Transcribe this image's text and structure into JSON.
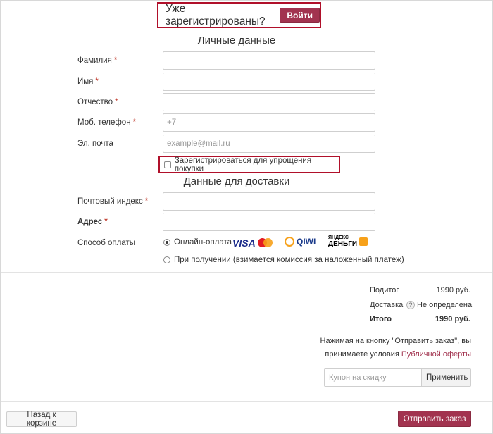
{
  "header": {
    "registered_question": "Уже зарегистрированы?",
    "login_button": "Войти"
  },
  "personal": {
    "title": "Личные данные",
    "fields": [
      {
        "label": "Фамилия",
        "required": "*",
        "value": "",
        "placeholder": ""
      },
      {
        "label": "Имя",
        "required": "*",
        "value": "",
        "placeholder": ""
      },
      {
        "label": "Отчество",
        "required": "*",
        "value": "",
        "placeholder": ""
      },
      {
        "label": "Моб. телефон",
        "required": "*",
        "value": "",
        "placeholder": "+7"
      },
      {
        "label": "Эл. почта",
        "required": "",
        "value": "",
        "placeholder": "example@mail.ru"
      }
    ],
    "register_checkbox_label": "Зарегистрироваться для упрощения покупки"
  },
  "delivery": {
    "title": "Данные для доставки",
    "postal_code": {
      "label": "Почтовый индекс",
      "required": "*",
      "value": ""
    },
    "address": {
      "label": "Адрес",
      "required": "*",
      "value": ""
    },
    "payment": {
      "label": "Способ оплаты",
      "options": [
        {
          "label": "Онлайн-оплата",
          "checked": true
        },
        {
          "label": "При получении (взимается комиссия за наложенный платеж)",
          "checked": false
        }
      ],
      "logos": {
        "visa": "VISA",
        "mastercard": "mastercard",
        "qiwi": "QIWI",
        "yandex_small": "ЯНДЕКС",
        "yandex_big": "ДЕНЬГИ"
      }
    }
  },
  "summary": {
    "subtotal_label": "Подитог",
    "subtotal_value": "1990 руб.",
    "delivery_label": "Доставка",
    "delivery_help": "?",
    "delivery_value": "Не определена",
    "total_label": "Итого",
    "total_value": "1990 руб."
  },
  "terms": {
    "line1": "Нажимая на кнопку \"Отправить заказ\", вы",
    "line2_prefix": "принимаете условия ",
    "line2_link": "Публичной оферты"
  },
  "coupon": {
    "placeholder": "Купон на скидку",
    "apply_button": "Применить"
  },
  "footer": {
    "back_button": "Назад к корзине",
    "submit_button": "Отправить заказ"
  },
  "colors": {
    "accent": "#a2334f",
    "highlight_border": "#b0102a",
    "required": "#c0392b"
  }
}
